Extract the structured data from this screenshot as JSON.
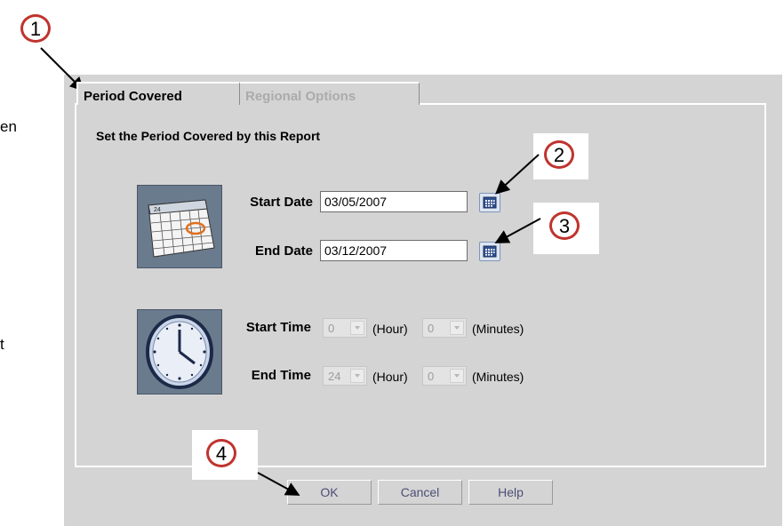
{
  "left_fragments": [
    "en",
    "t"
  ],
  "tabs": {
    "period": "Period Covered",
    "regional": "Regional Options"
  },
  "panel": {
    "heading": "Set the Period Covered by this Report"
  },
  "dates": {
    "start_label": "Start Date",
    "start_value": "03/05/2007",
    "end_label": "End Date",
    "end_value": "03/12/2007"
  },
  "times": {
    "start_label": "Start Time",
    "start_hour": "0",
    "start_minutes": "0",
    "end_label": "End Time",
    "end_hour": "24",
    "end_minutes": "0",
    "hour_unit": "(Hour)",
    "minutes_unit": "(Minutes)"
  },
  "buttons": {
    "ok": "OK",
    "cancel": "Cancel",
    "help": "Help"
  },
  "callouts": [
    "1",
    "2",
    "3",
    "4"
  ],
  "icons": {
    "calendar": "calendar-icon",
    "clock": "clock-icon",
    "date_picker": "calendar-picker-icon"
  },
  "colors": {
    "callout_ring": "#c0332e",
    "dialog_bg": "#d4d4d4",
    "icon_bg": "#6b7b8e"
  }
}
